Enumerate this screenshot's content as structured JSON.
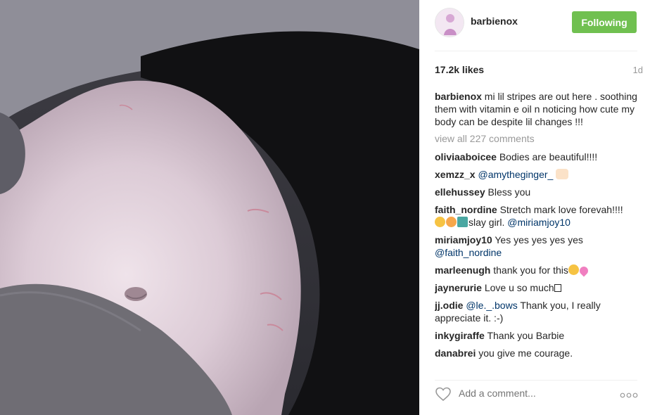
{
  "post": {
    "username": "barbienox",
    "follow_label": "Following",
    "likes": "17.2k likes",
    "age": "1d",
    "caption": "mi lil stripes are out here . soothing them with vitamin e oil n noticing how cute my body can be despite lil changes !!!",
    "view_all": "view all 227 comments",
    "add_comment_placeholder": "Add a comment..."
  },
  "comments": [
    {
      "user": "oliviaaboicee",
      "text": "Bodies are beautiful!!!!"
    },
    {
      "user": "xemzz_x",
      "mention": "@amytheginger_",
      "emoji": "hands"
    },
    {
      "user": "ellehussey",
      "text": "Bless you"
    },
    {
      "user": "faith_nordine",
      "text": "Stretch mark love forevah!!!!",
      "text2": "slay girl.",
      "mention": "@miriamjoy10"
    },
    {
      "user": "miriamjoy10",
      "text": "Yes yes yes yes yes",
      "mention": "@faith_nordine"
    },
    {
      "user": "marleenugh",
      "text": "thank you for this"
    },
    {
      "user": "jaynerurie",
      "text": "Love u so much"
    },
    {
      "user": "jj.odie",
      "mention": "@le._.bows",
      "text": "Thank you, I really appreciate it. :-)"
    },
    {
      "user": "inkygiraffe",
      "text": "Thank you Barbie"
    },
    {
      "user": "danabrei",
      "text": "you give me courage."
    }
  ],
  "colors": {
    "follow_button": "#70c050",
    "mention": "#003569",
    "muted": "#999999"
  },
  "icons": {
    "like": "heart-outline-icon",
    "more": "ellipsis-icon"
  }
}
